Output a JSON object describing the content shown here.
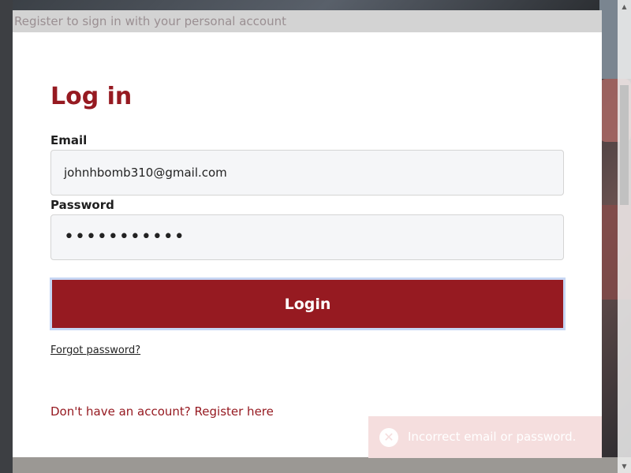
{
  "header": {
    "text": "Register to sign in with your personal account"
  },
  "form": {
    "title": "Log in",
    "email_label": "Email",
    "email_value": "johnhbomb310@gmail.com",
    "password_label": "Password",
    "password_value": "•••••••••••",
    "login_label": "Login",
    "forgot_link": "Forgot password?",
    "register_link": "Don't have an account? Register here"
  },
  "toast": {
    "message": "Incorrect email or password.",
    "icon": "error-x-icon"
  },
  "colors": {
    "brand": "#961a21",
    "toast_bg": "#f5dede",
    "header_bg": "#d3d3d3"
  }
}
